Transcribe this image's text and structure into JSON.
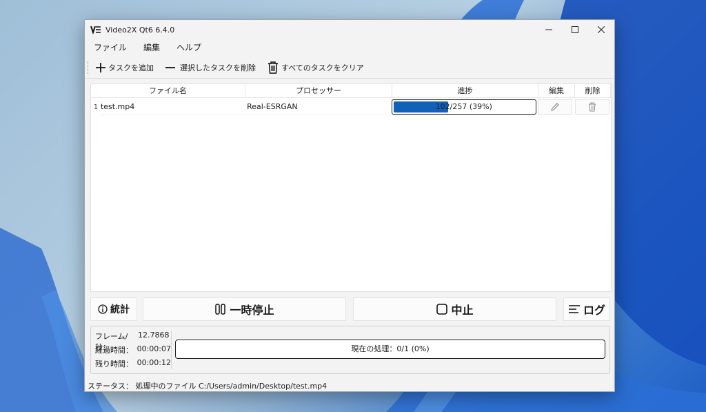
{
  "window": {
    "title": "Video2X Qt6 6.4.0"
  },
  "menu": {
    "items": [
      "ファイル",
      "編集",
      "ヘルプ"
    ]
  },
  "toolbar": {
    "add_label": "タスクを追加",
    "remove_label": "選択したタスクを削除",
    "clear_label": "すべてのタスクをクリア"
  },
  "table": {
    "headers": [
      "ファイル名",
      "プロセッサー",
      "進捗",
      "編集",
      "削除"
    ],
    "rows": [
      {
        "num": "1",
        "filename": "test.mp4",
        "processor": "Real-ESRGAN",
        "progress_text": "102/257 (39%)",
        "progress_fraction": 0.39
      }
    ]
  },
  "controls": {
    "stats_label": "統計",
    "pause_label": "一時停止",
    "stop_label": "中止",
    "log_label": "ログ"
  },
  "stats": {
    "fps_label": "フレーム/秒：",
    "fps_value": "12.7868",
    "elapsed_label": "経過時間：",
    "elapsed_value": "00:00:07",
    "remaining_label": "残り時間：",
    "remaining_value": "00:00:12",
    "overall_text": "現在の処理：0/1 (0%)",
    "overall_fraction": 0
  },
  "statusbar": {
    "text": "ステータス： 処理中のファイル C:/Users/admin/Desktop/test.mp4"
  },
  "colors": {
    "accent": "#1061b8",
    "window_bg": "#f3f3f3"
  }
}
